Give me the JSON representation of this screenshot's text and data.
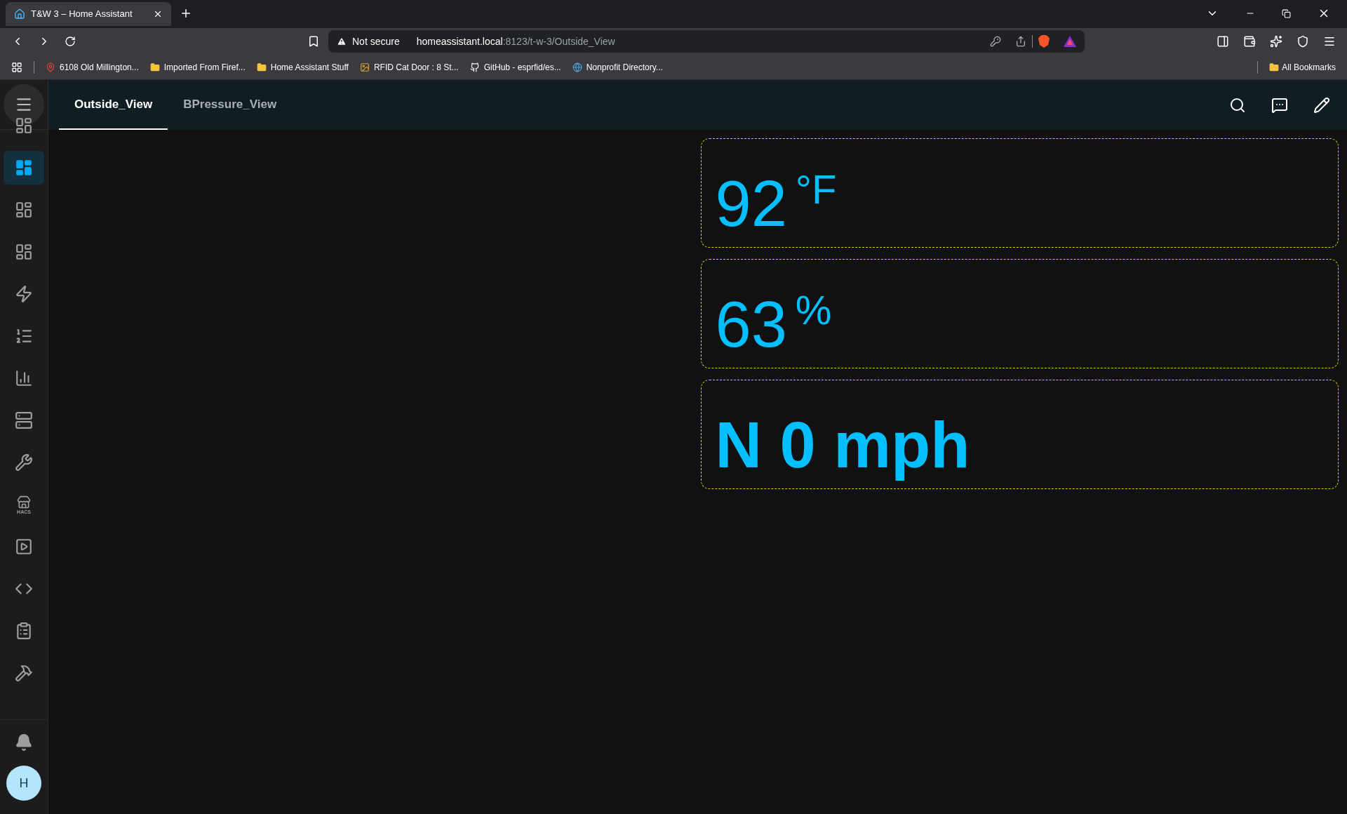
{
  "browser": {
    "tabs": [
      {
        "title": "T&W 3 – Home Assistant",
        "selected": true
      }
    ],
    "address": {
      "security": "Not secure",
      "url_host": "homeassistant.local",
      "url_rest": ":8123/t-w-3/Outside_View"
    },
    "bookmarks": [
      {
        "kind": "map",
        "label": "6108 Old Millington..."
      },
      {
        "kind": "folder",
        "label": "Imported From Firef..."
      },
      {
        "kind": "folder",
        "label": "Home Assistant Stuff"
      },
      {
        "kind": "image",
        "label": "RFID Cat Door : 8 St..."
      },
      {
        "kind": "github",
        "label": "GitHub - esprfid/es..."
      },
      {
        "kind": "globe",
        "label": "Nonprofit Directory..."
      }
    ],
    "all_bookmarks": "All Bookmarks"
  },
  "views": [
    {
      "label": "Outside_View",
      "selected": true
    },
    {
      "label": "BPressure_View",
      "selected": false
    }
  ],
  "sidebar": {
    "items": [
      {
        "kind": "dashboard",
        "selected": false
      },
      {
        "kind": "dashboard",
        "selected": true
      },
      {
        "kind": "dashboard",
        "selected": false
      },
      {
        "kind": "dashboard",
        "selected": false
      },
      {
        "kind": "energy",
        "selected": false
      },
      {
        "kind": "list",
        "selected": false
      },
      {
        "kind": "chart",
        "selected": false
      },
      {
        "kind": "server",
        "selected": false
      },
      {
        "kind": "wrench",
        "selected": false
      },
      {
        "kind": "store",
        "selected": false,
        "caption": "HACS"
      },
      {
        "kind": "media",
        "selected": false
      },
      {
        "kind": "code",
        "selected": false
      },
      {
        "kind": "clipboard",
        "selected": false
      },
      {
        "kind": "hammer",
        "selected": false
      }
    ],
    "avatar": "H"
  },
  "cards": [
    {
      "kind": "reading",
      "value": "92",
      "unit": "°F"
    },
    {
      "kind": "reading",
      "value": "63",
      "unit": "%"
    },
    {
      "kind": "headline",
      "value": "N 0 mph"
    }
  ]
}
